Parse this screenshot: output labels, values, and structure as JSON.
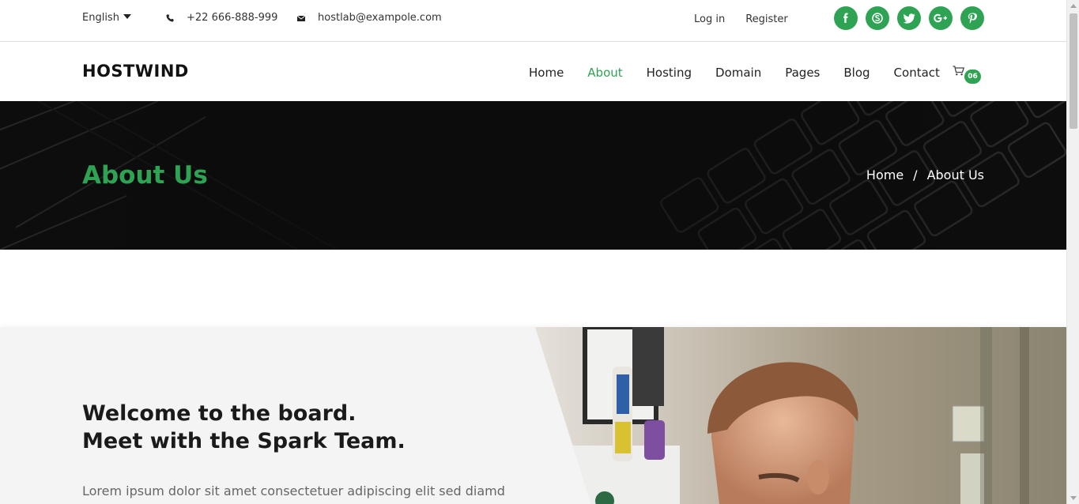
{
  "topbar": {
    "language": "English",
    "phone": "+22 666-888-999",
    "email": "hostlab@exampole.com",
    "login": "Log in",
    "register": "Register",
    "social_icons": [
      "facebook-icon",
      "skype-icon",
      "twitter-icon",
      "google-plus-icon",
      "pinterest-icon"
    ]
  },
  "nav": {
    "logo": "HOSTWIND",
    "menu": [
      "Home",
      "About",
      "Hosting",
      "Domain",
      "Pages",
      "Blog",
      "Contact"
    ],
    "active": "About",
    "cart_count": "06"
  },
  "banner": {
    "title": "About Us",
    "breadcrumb": [
      "Home",
      "About Us"
    ],
    "separator": "/"
  },
  "about": {
    "heading_line1": "Welcome to the board.",
    "heading_line2": "Meet with the Spark Team.",
    "paragraph": "Lorem ipsum dolor sit amet consectetuer adipiscing elit sed diamd"
  },
  "colors": {
    "accent": "#2ea353",
    "banner_bg": "#0b0b0b",
    "section_bg": "#f4f4f4"
  }
}
